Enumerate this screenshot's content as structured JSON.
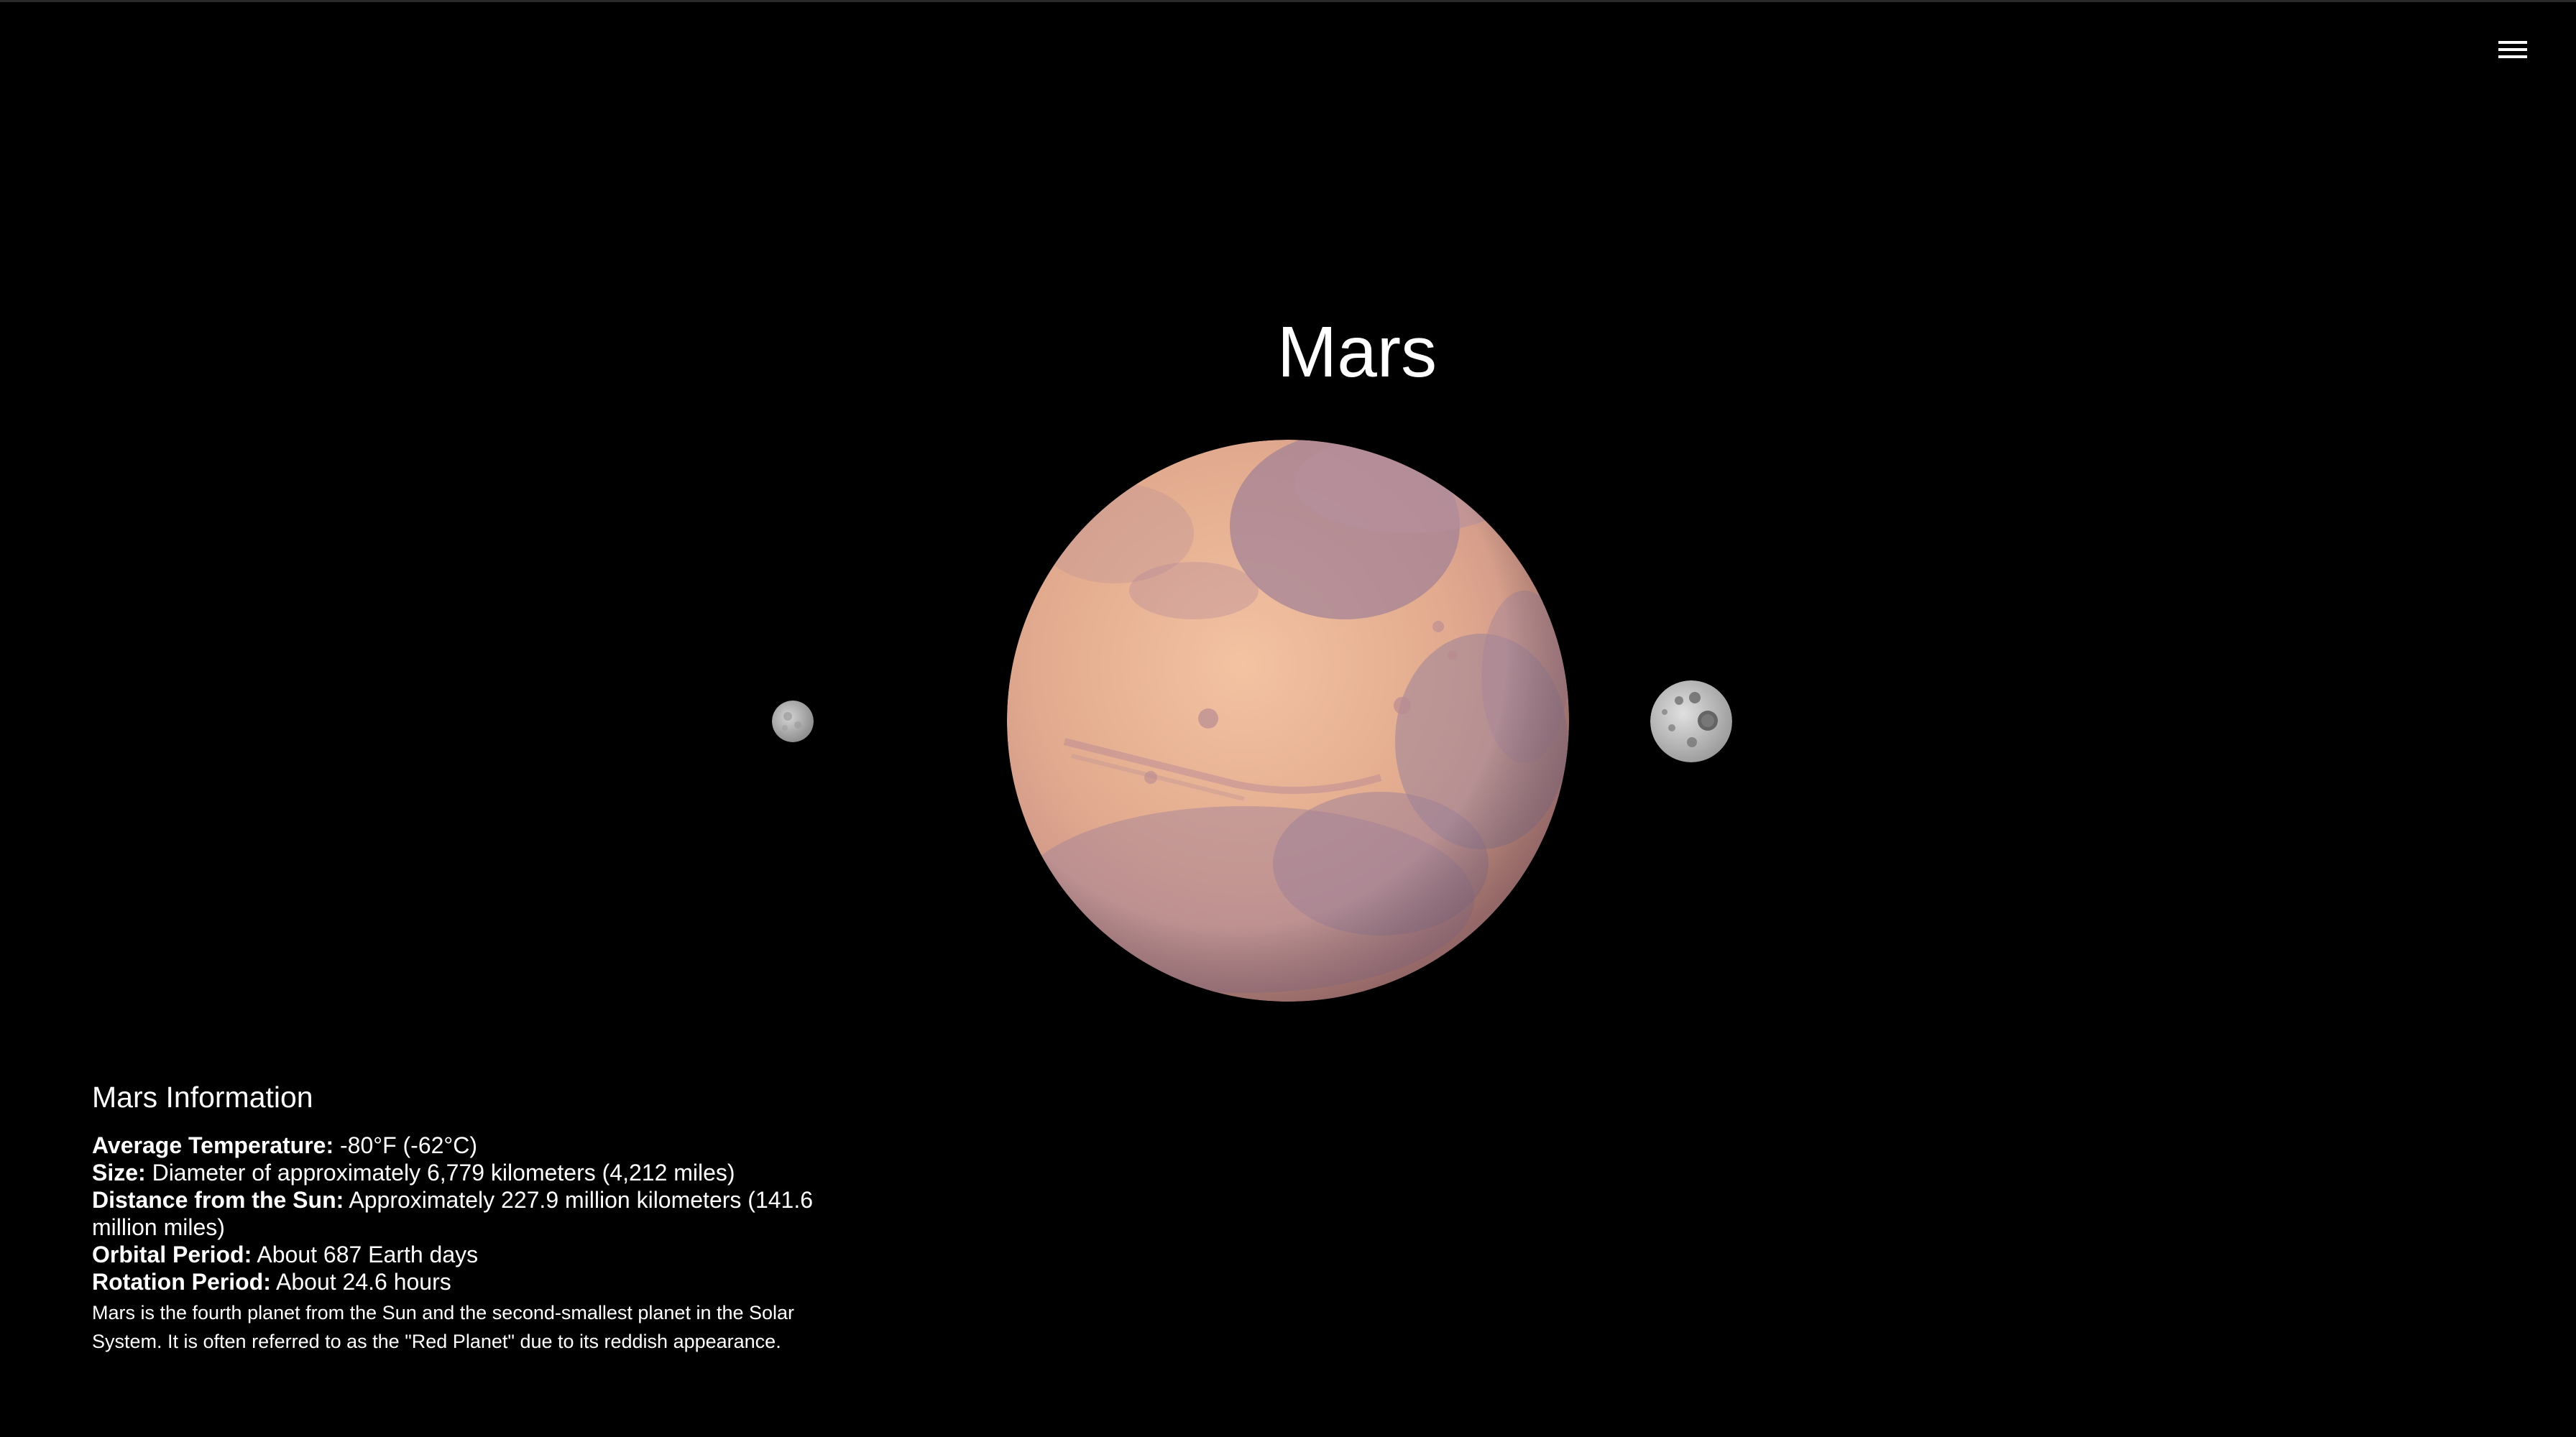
{
  "header": {
    "menu_icon": "hamburger-menu-icon"
  },
  "planet": {
    "name": "Mars",
    "colors": {
      "surface": "#e6b08e",
      "surface_dark": "#a58397",
      "moon": "#bdbdbd"
    }
  },
  "info": {
    "heading": "Mars Information",
    "rows": [
      {
        "label": "Average Temperature:",
        "value": " -80°F (-62°C)"
      },
      {
        "label": "Size:",
        "value": " Diameter of approximately 6,779 kilometers (4,212 miles)"
      },
      {
        "label": "Distance from the Sun:",
        "value": " Approximately 227.9 million kilometers (141.6 million miles)"
      },
      {
        "label": "Orbital Period:",
        "value": " About 687 Earth days"
      },
      {
        "label": "Rotation Period:",
        "value": " About 24.6 hours"
      }
    ],
    "description": "Mars is the fourth planet from the Sun and the second-smallest planet in the Solar System. It is often referred to as the \"Red Planet\" due to its reddish appearance."
  }
}
